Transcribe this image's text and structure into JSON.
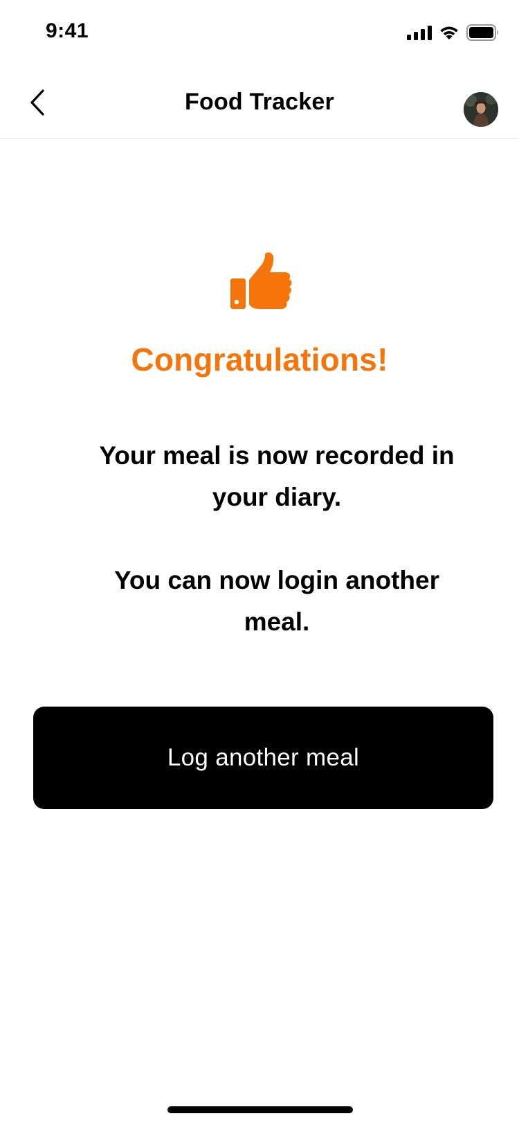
{
  "status_bar": {
    "time": "9:41",
    "icons": [
      "signal-icon",
      "wifi-icon",
      "battery-icon"
    ]
  },
  "nav": {
    "title": "Food Tracker",
    "back_icon": "chevron-left-icon",
    "avatar": "user-avatar"
  },
  "content": {
    "icon": "thumbs-up-icon",
    "heading": "Congratulations!",
    "message_1": "Your meal is now recorded in your diary.",
    "message_2": "You can now login another meal."
  },
  "actions": {
    "primary_label": "Log another meal"
  },
  "colors": {
    "accent": "#f6750b",
    "button_bg": "#000000",
    "button_text": "#ffffff"
  }
}
